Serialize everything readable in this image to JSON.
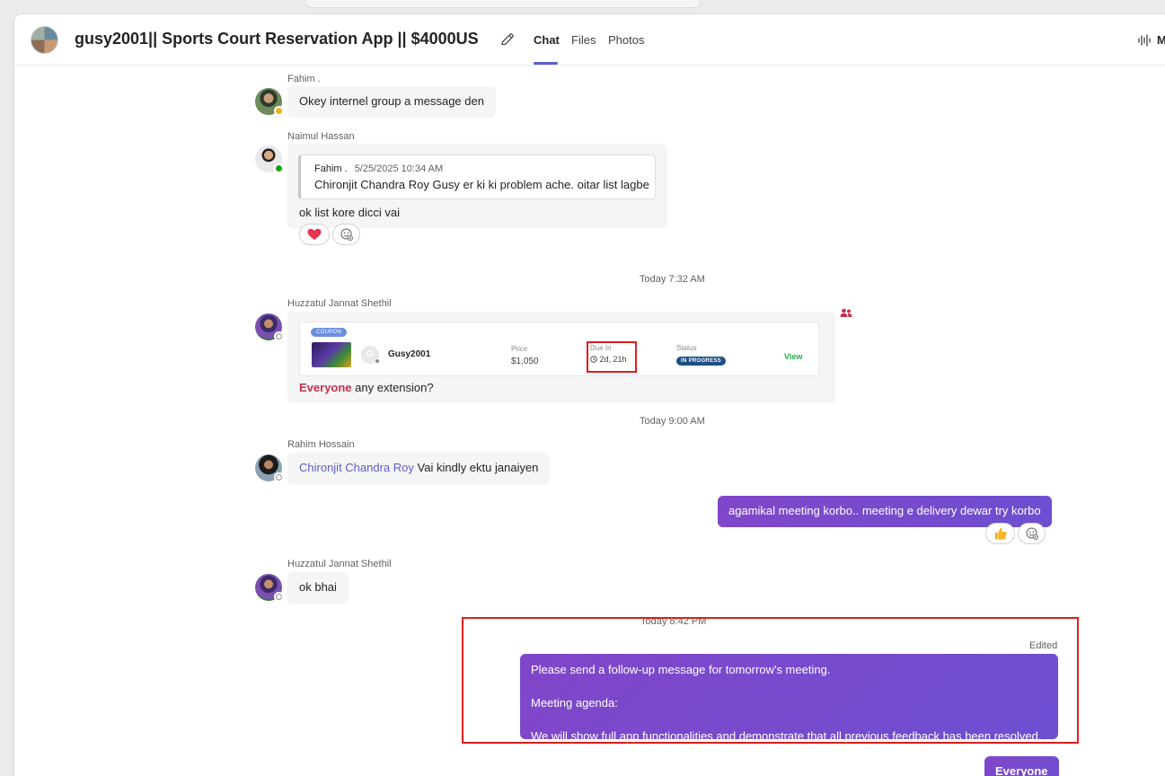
{
  "header": {
    "title": "gusy2001|| Sports Court Reservation App || $4000US",
    "tabs": [
      {
        "label": "Chat",
        "active": true
      },
      {
        "label": "Files",
        "active": false
      },
      {
        "label": "Photos",
        "active": false
      }
    ],
    "meet_label": "M"
  },
  "colors": {
    "accent": "#5b5fc7",
    "my_bubble": "#7b4dd0",
    "highlight_red": "#e01d1d",
    "mention_everyone": "#c4314b"
  },
  "messages": {
    "m1": {
      "sender": "Fahim .",
      "text": "Okey internel group a message den"
    },
    "m2": {
      "sender": "Naimul Hassan",
      "quote": {
        "author": "Fahim .",
        "time": "5/25/2025 10:34 AM",
        "text": "Chironjit Chandra Roy Gusy er ki ki problem ache. oitar list lagbe"
      },
      "text": "ok list kore dicci vai",
      "reaction": "heart-reaction"
    },
    "ts1": "Today 7:32 AM",
    "m3": {
      "sender": "Huzzatul Jannat Shethil",
      "card": {
        "badge": "COUPON",
        "avatar_letter": "G",
        "seller": "Gusy2001",
        "price_label": "Price",
        "price": "$1,050",
        "due_label": "Due In",
        "due": "2d, 21h",
        "status_label": "Status",
        "status": "IN PROGRESS",
        "view": "View"
      },
      "mention": "Everyone",
      "text": " any extension?"
    },
    "ts2": "Today 9:00 AM",
    "m4": {
      "sender": "Rahim Hossain",
      "mention": "Chironjit Chandra Roy",
      "text": " Vai kindly ektu janaiyen"
    },
    "m5": {
      "text": "agamikal meeting korbo.. meeting e delivery dewar try korbo",
      "reaction": "thumbs-up-reaction"
    },
    "m6": {
      "sender": "Huzzatul Jannat Shethil",
      "text": "ok bhai"
    },
    "ts3": "Today 8:42 PM",
    "m7": {
      "edited": "Edited",
      "line1": "Please send a follow-up message for tomorrow's meeting.",
      "line2": "Meeting agenda:",
      "line3": "We will show full app functionalities and demonstrate that all previous feedback has been resolved."
    },
    "m8": {
      "text": "Everyone"
    }
  }
}
